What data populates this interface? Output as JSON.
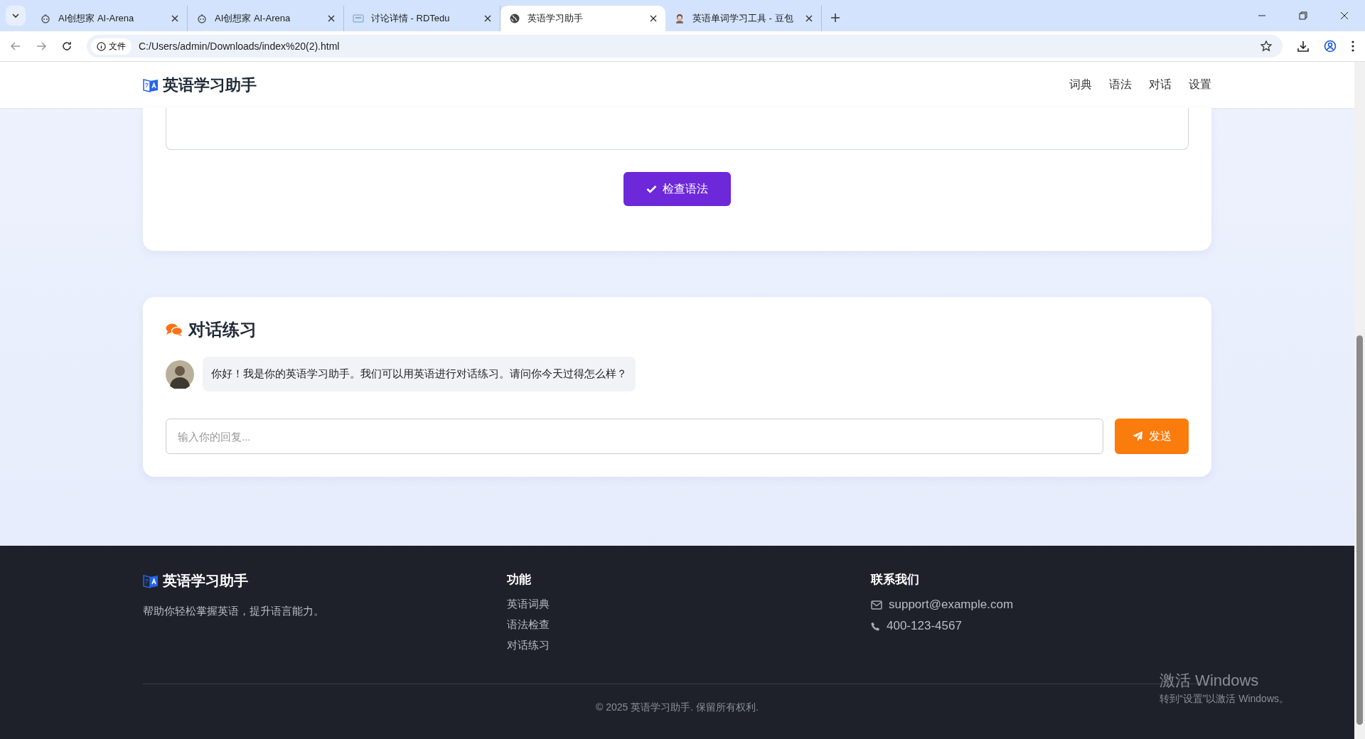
{
  "browser": {
    "tabs": [
      {
        "title": "AI创想家 AI-Arena",
        "kind": "robot",
        "selected": false
      },
      {
        "title": "AI创想家 AI-Arena",
        "kind": "robot",
        "selected": false
      },
      {
        "title": "讨论详情 - RDTedu",
        "kind": "page",
        "selected": false
      },
      {
        "title": "英语学习助手",
        "kind": "globe",
        "selected": true
      },
      {
        "title": "英语单词学习工具 - 豆包",
        "kind": "person",
        "selected": false
      }
    ],
    "security_label": "文件",
    "url": "C:/Users/admin/Downloads/index%20(2).html"
  },
  "header": {
    "brand": "英语学习助手",
    "nav": [
      "词典",
      "语法",
      "对话",
      "设置"
    ]
  },
  "grammar_card": {
    "button": "检查语法"
  },
  "chat_card": {
    "title": "对话练习",
    "messages": [
      {
        "text": "你好！我是你的英语学习助手。我们可以用英语进行对话练习。请问你今天过得怎么样？"
      }
    ],
    "input_placeholder": "输入你的回复...",
    "send_button": "发送"
  },
  "footer": {
    "brand": "英语学习助手",
    "description": "帮助你轻松掌握英语，提升语言能力。",
    "features_title": "功能",
    "features": [
      "英语词典",
      "语法检查",
      "对话练习"
    ],
    "contact_title": "联系我们",
    "contacts": [
      {
        "kind": "email",
        "text": "support@example.com"
      },
      {
        "kind": "phone",
        "text": "400-123-4567"
      }
    ],
    "copyright": "© 2025 英语学习助手. 保留所有权利."
  },
  "windows_notice": {
    "title": "激活 Windows",
    "subtitle": "转到“设置”以激活 Windows。"
  }
}
